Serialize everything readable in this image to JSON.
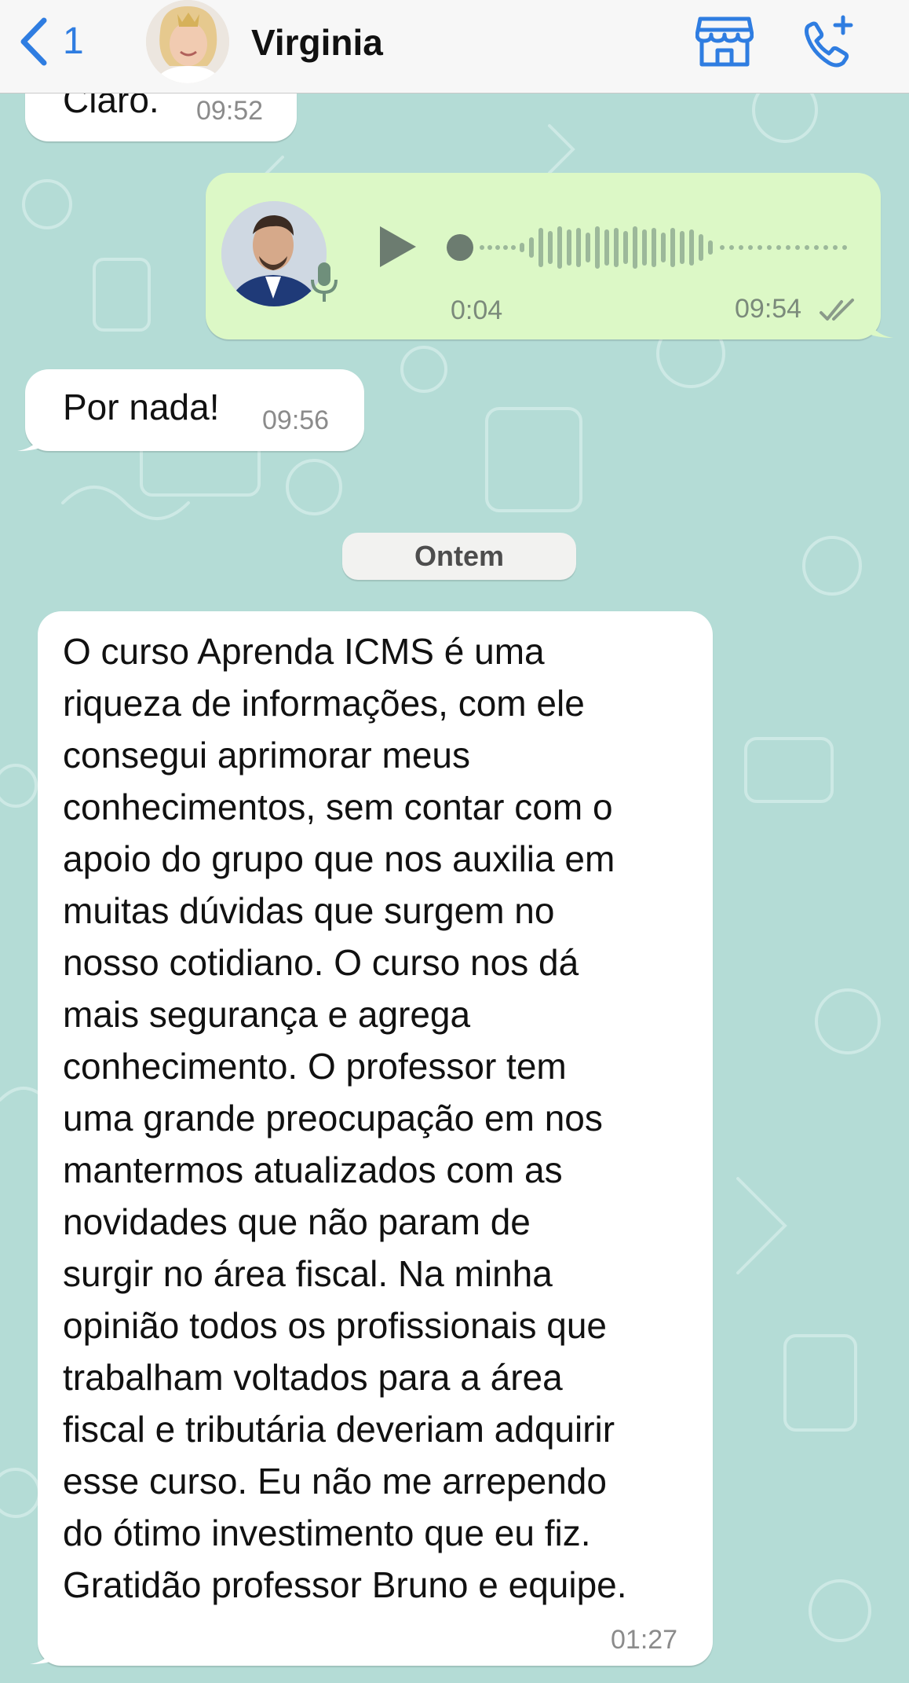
{
  "header": {
    "back_count": "1",
    "contact_name": "Virginia",
    "icons": [
      "back-chevron-icon",
      "store-icon",
      "add-call-icon"
    ],
    "accent_color": "#2f7de1"
  },
  "messages": [
    {
      "direction": "in",
      "text": "Claro.",
      "time": "09:52"
    },
    {
      "direction": "out",
      "type": "voice",
      "duration": "0:04",
      "time": "09:54",
      "status": "read-ticks-icon"
    },
    {
      "direction": "in",
      "text": "Por nada!",
      "time": "09:56"
    }
  ],
  "date_divider": "Ontem",
  "review": {
    "text": "O curso Aprenda ICMS é uma\nriqueza de informações, com ele\nconsegui aprimorar meus\nconhecimentos, sem contar com o\napoio do grupo que nos auxilia em\nmuitas dúvidas que surgem no\nnosso cotidiano. O curso nos dá\nmais segurança e agrega\nconhecimento. O professor tem\numa grande preocupação em nos\nmantermos atualizados com as\nnovidades que não param de\nsurgir no área fiscal. Na minha\nopinião todos os profissionais que\ntrabalham voltados para a área\nfiscal e tributária deveriam adquirir\nesse curso. Eu não me arrependo\ndo ótimo investimento que eu fiz.\nGratidão professor Bruno e equipe.",
    "time": "01:27"
  },
  "colors": {
    "wallpaper": "#b4dcd6",
    "incoming_bubble": "#ffffff",
    "outgoing_bubble": "#dcf8c6"
  }
}
